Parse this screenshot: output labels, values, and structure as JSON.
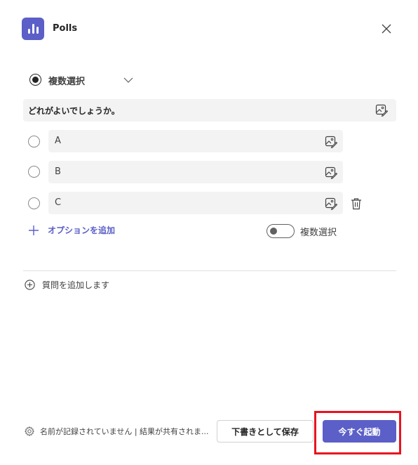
{
  "header": {
    "app_icon": "poll-chart-icon",
    "title": "Polls",
    "close_icon": "close-icon"
  },
  "question_type": {
    "label": "複数選択",
    "selected": true
  },
  "question": {
    "text": "どれがよいでしょうか。"
  },
  "options": [
    {
      "label": "A"
    },
    {
      "label": "B"
    },
    {
      "label": "C"
    }
  ],
  "add_option": {
    "label": "オプションを追加"
  },
  "multi_select_toggle": {
    "label": "複数選択",
    "on": false
  },
  "add_question": {
    "label": "質問を追加します"
  },
  "footer": {
    "settings_text": "名前が記録されていません | 結果が共有されま...",
    "save_draft_label": "下書きとして保存",
    "launch_label": "今すぐ起動"
  },
  "colors": {
    "accent": "#5b5fc7",
    "highlight": "#e8131f",
    "field_bg": "#f3f3f3"
  }
}
